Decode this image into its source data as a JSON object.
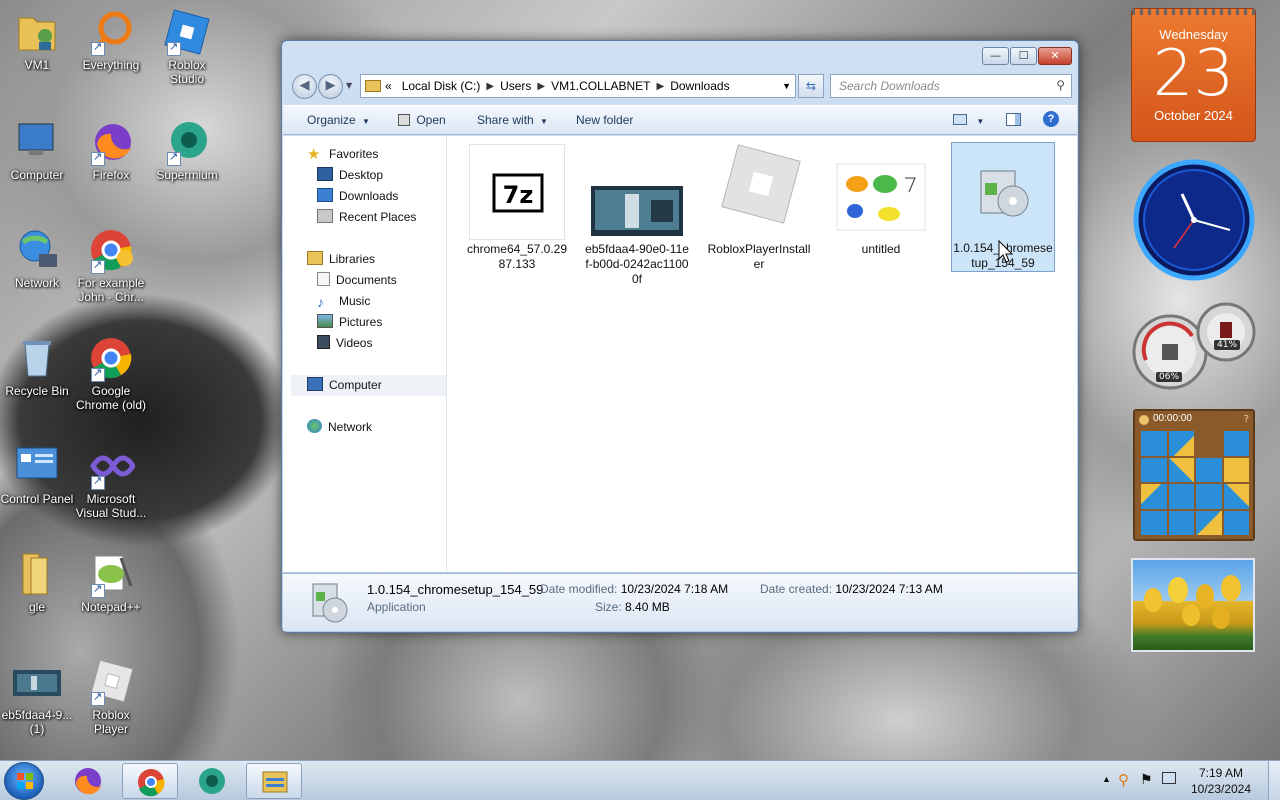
{
  "desktop_icons": [
    {
      "label": "VM1"
    },
    {
      "label": "Everything"
    },
    {
      "label": "Roblox Studio"
    },
    {
      "label": "Computer"
    },
    {
      "label": "Firefox"
    },
    {
      "label": "Supermium"
    },
    {
      "label": "Network"
    },
    {
      "label": "For example John - Chr..."
    },
    {
      "label": "Recycle Bin"
    },
    {
      "label": "Google Chrome (old)"
    },
    {
      "label": "Control Panel"
    },
    {
      "label": "Microsoft Visual Stud..."
    },
    {
      "label": "gle"
    },
    {
      "label": "Notepad++"
    },
    {
      "label": "eb5fdaa4-9... (1)"
    },
    {
      "label": "Roblox Player"
    }
  ],
  "window": {
    "controls": {
      "minimize": "—",
      "maximize": "☐",
      "close": "✕"
    },
    "back_icon": "back-arrow-icon",
    "forward_icon": "forward-arrow-icon",
    "address": {
      "prefix": "«",
      "crumbs": [
        "Local Disk (C:)",
        "Users",
        "VM1.COLLABNET",
        "Downloads"
      ]
    },
    "search_placeholder": "Search Downloads",
    "toolbar": {
      "organize": "Organize",
      "open": "Open",
      "share_with": "Share with",
      "new_folder": "New folder"
    },
    "nav_pane": {
      "favorites": "Favorites",
      "desktop": "Desktop",
      "downloads": "Downloads",
      "recent": "Recent Places",
      "libraries": "Libraries",
      "documents": "Documents",
      "music": "Music",
      "pictures": "Pictures",
      "videos": "Videos",
      "computer": "Computer",
      "network": "Network"
    },
    "files": [
      {
        "name": "chrome64_57.0.2987.133"
      },
      {
        "name": "eb5fdaa4-90e0-11ef-b00d-0242ac11000f"
      },
      {
        "name": "RobloxPlayerInstaller"
      },
      {
        "name": "untitled"
      },
      {
        "name": "1.0.154_chromesetup_154_59"
      }
    ],
    "details": {
      "name": "1.0.154_chromesetup_154_59",
      "type": "Application",
      "modified_label": "Date modified:",
      "modified": "10/23/2024 7:18 AM",
      "created_label": "Date created:",
      "created": "10/23/2024 7:13 AM",
      "size_label": "Size:",
      "size": "8.40 MB"
    }
  },
  "gadgets": {
    "calendar": {
      "day": "Wednesday",
      "date": "23",
      "month": "October 2024"
    },
    "cpu": {
      "cpu_percent": "06%",
      "mem_percent": "41%"
    },
    "puzzle": {
      "timer": "00:00:00"
    }
  },
  "taskbar": {
    "time": "7:19 AM",
    "date": "10/23/2024"
  },
  "colors": {
    "calendar_orange": "#e2621c",
    "selection_blue": "#cce4f7",
    "taskbar": "#c8d6e6"
  }
}
